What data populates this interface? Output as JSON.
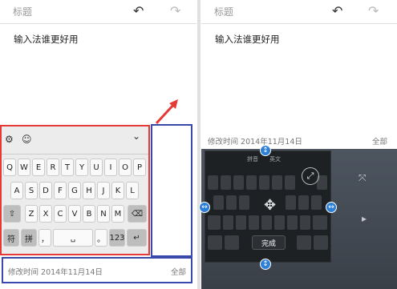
{
  "left": {
    "title_placeholder": "标题",
    "undo_icon": "↶",
    "redo_icon": "↷",
    "note_text": "输入法谁更好用",
    "footer_time": "修改时间 2014年11月14日",
    "footer_all": "全部",
    "keyboard": {
      "toolbar_left_icon": "⚙",
      "toolbar_smile_icon": "☺",
      "toolbar_collapse_icon": "⌄",
      "row1": [
        "Q",
        "W",
        "E",
        "R",
        "T",
        "Y",
        "U",
        "I",
        "O",
        "P"
      ],
      "row2": [
        "A",
        "S",
        "D",
        "F",
        "G",
        "H",
        "J",
        "K",
        "L"
      ],
      "row3": [
        "⇧",
        "Z",
        "X",
        "C",
        "V",
        "B",
        "N",
        "M",
        "⌫"
      ],
      "row4": [
        "符",
        "拼",
        "，",
        "␣",
        "。",
        "123",
        "↵"
      ]
    }
  },
  "right": {
    "title_placeholder": "标题",
    "undo_icon": "↶",
    "redo_icon": "↷",
    "note_text": "输入法谁更好用",
    "footer_time": "修改时间 2014年11月14日",
    "footer_all": "全部",
    "keyboard": {
      "toolbar_items": [
        "拼音",
        "英文"
      ],
      "done_label": "完成"
    }
  },
  "colors": {
    "red_outline": "#e53935",
    "blue_outline": "#3949ab",
    "handle_blue": "#2e7fd6"
  }
}
